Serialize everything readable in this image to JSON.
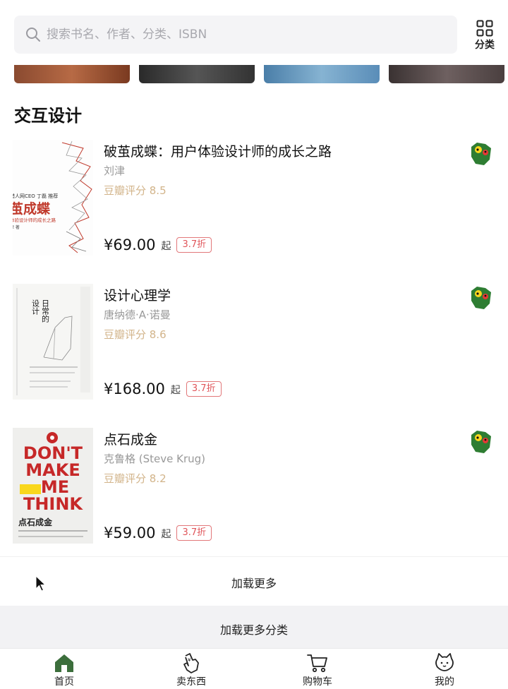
{
  "search": {
    "placeholder": "搜索书名、作者、分类、ISBN"
  },
  "header": {
    "category_label": "分类"
  },
  "section": {
    "title": "交互设计"
  },
  "books": [
    {
      "title": "破茧成蝶：用户体验设计师的成长之路",
      "author": "刘津",
      "rating": "豆瓣评分 8.5",
      "price": "¥69.00",
      "suffix": "起",
      "discount": "3.7折",
      "cover_text": [
        "猎人网CEO 丁磊 推荐",
        "茧成蝶",
        "体验设计师的成长之路",
        "津 著"
      ]
    },
    {
      "title": "设计心理学",
      "author": "唐纳德·A·诺曼",
      "rating": "豆瓣评分 8.6",
      "price": "¥168.00",
      "suffix": "起",
      "discount": "3.7折",
      "cover_text": [
        "日常的",
        "设计"
      ]
    },
    {
      "title": "点石成金",
      "author": "克鲁格 (Steve Krug)",
      "rating": "豆瓣评分 8.2",
      "price": "¥59.00",
      "suffix": "起",
      "discount": "3.7折",
      "cover_text": [
        "DON'T",
        "MAKE",
        "ME",
        "THINK",
        "点石成金"
      ]
    }
  ],
  "actions": {
    "load_more": "加载更多",
    "load_more_categories": "加载更多分类"
  },
  "tabbar": {
    "tabs": [
      {
        "label": "首页",
        "icon": "home-icon"
      },
      {
        "label": "卖东西",
        "icon": "hand-icon"
      },
      {
        "label": "购物车",
        "icon": "cart-icon"
      },
      {
        "label": "我的",
        "icon": "cat-face-icon"
      }
    ]
  },
  "colors": {
    "accent_green": "#3c6e3c",
    "rating": "#d2b48a",
    "discount": "#e0555a"
  }
}
